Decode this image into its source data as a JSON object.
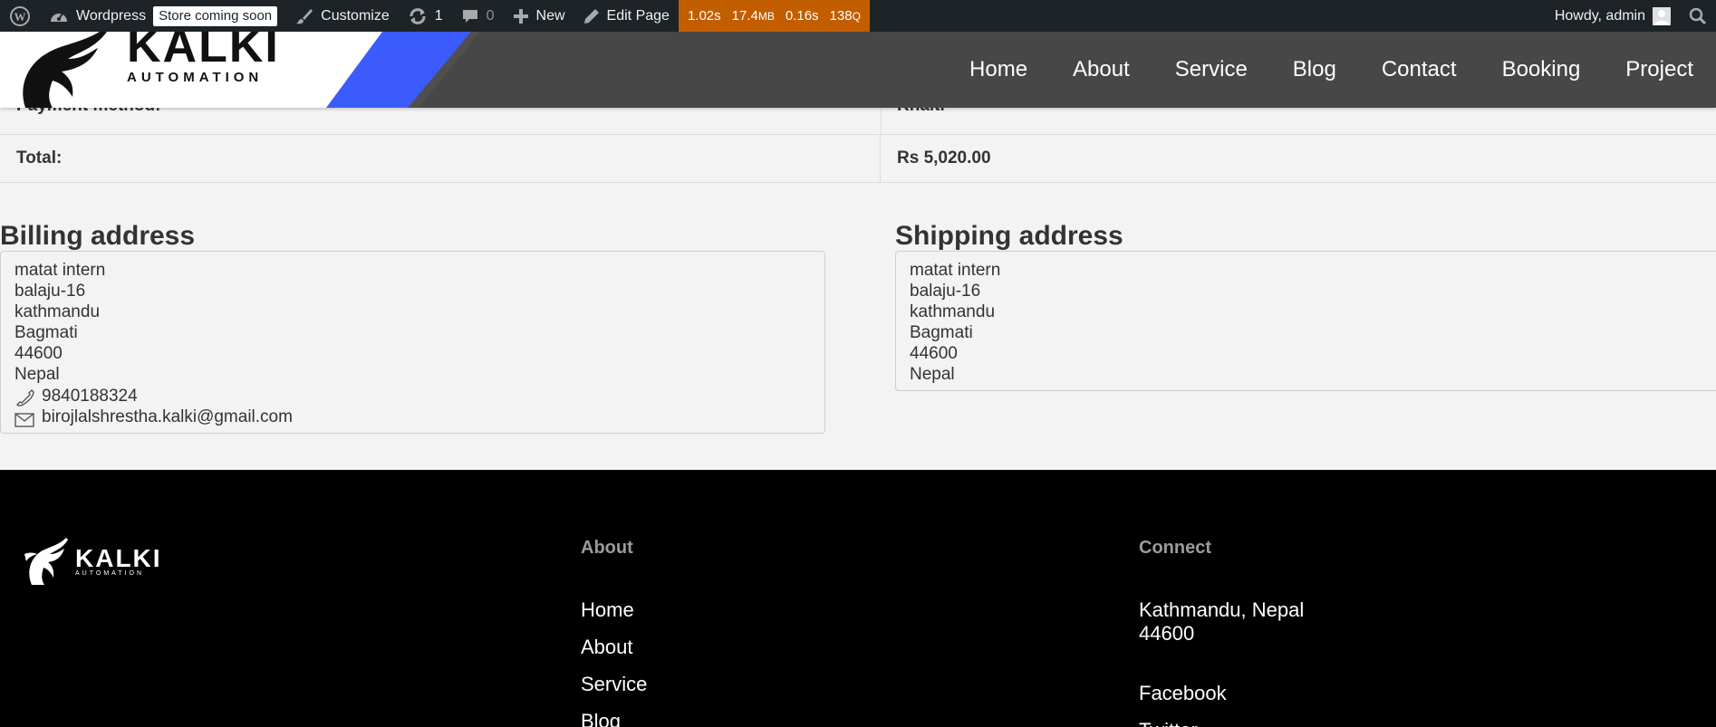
{
  "admin_bar": {
    "site_name": "Wordpress",
    "store_badge": "Store coming soon",
    "customize": "Customize",
    "updates_count": "1",
    "comments_count": "0",
    "new_label": "New",
    "edit_page": "Edit Page",
    "perf": {
      "time": "1.02s",
      "memory_value": "17.4",
      "memory_unit": "MB",
      "query_time": "0.16s",
      "queries_value": "138",
      "queries_unit": "Q"
    },
    "howdy": "Howdy, admin"
  },
  "header": {
    "logo_text": "KALKI",
    "logo_sub": "AUTOMATION",
    "colors": {
      "bar": "#474747",
      "accent": "#3b5bfd"
    },
    "nav": [
      "Home",
      "About",
      "Service",
      "Blog",
      "Contact",
      "Booking",
      "Project"
    ]
  },
  "order": {
    "payment_label": "Payment method:",
    "payment_value": "Khalti",
    "total_label": "Total:",
    "total_value": "Rs 5,020.00"
  },
  "billing": {
    "title": "Billing address",
    "lines": [
      "matat intern",
      "balaju-16",
      "kathmandu",
      "Bagmati",
      "44600",
      "Nepal"
    ],
    "phone": "9840188324",
    "email": "birojlalshrestha.kalki@gmail.com"
  },
  "shipping": {
    "title": "Shipping address",
    "lines": [
      "matat intern",
      "balaju-16",
      "kathmandu",
      "Bagmati",
      "44600",
      "Nepal"
    ]
  },
  "footer": {
    "logo_text": "KALKI",
    "logo_sub": "AUTOMATION",
    "about_heading": "About",
    "about_links": [
      "Home",
      "About",
      "Service",
      "Blog"
    ],
    "connect_heading": "Connect",
    "address_line1": "Kathmandu, Nepal",
    "address_line2": "44600",
    "social": [
      "Facebook",
      "Twitter"
    ]
  }
}
